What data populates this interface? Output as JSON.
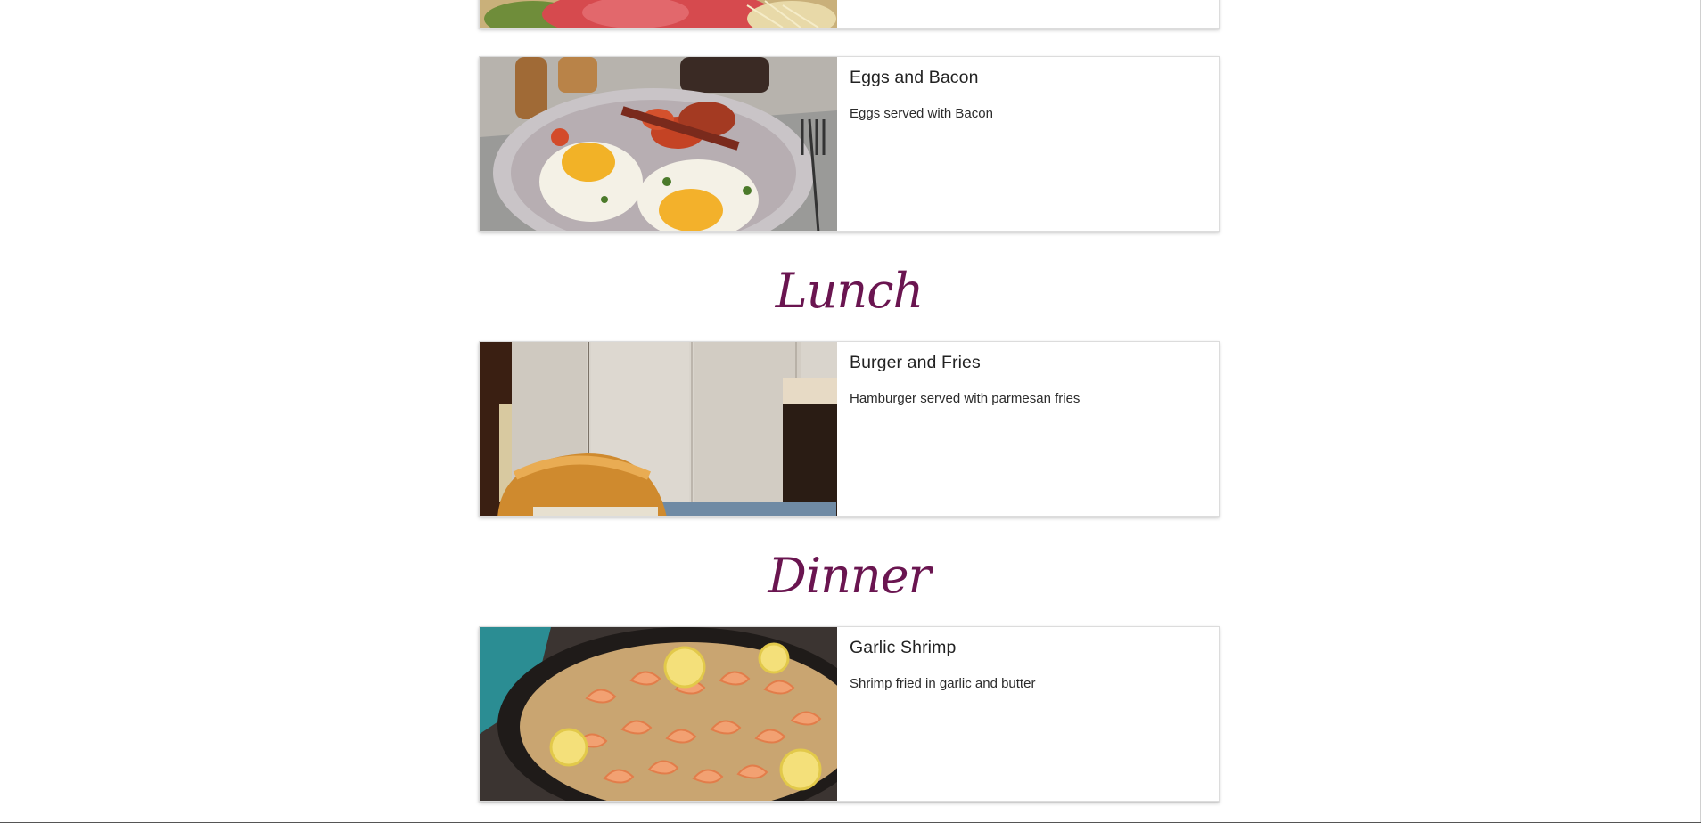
{
  "sections": {
    "lunch_heading": "Lunch",
    "dinner_heading": "Dinner"
  },
  "items": [
    {
      "title": "Eggs and Bacon",
      "description": "Eggs served with Bacon"
    },
    {
      "title": "Burger and Fries",
      "description": "Hamburger served with parmesan fries"
    },
    {
      "title": "Garlic Shrimp",
      "description": "Shrimp fried in garlic and butter"
    }
  ],
  "colors": {
    "heading": "#6a1550",
    "card_border": "#dcdcdc"
  }
}
